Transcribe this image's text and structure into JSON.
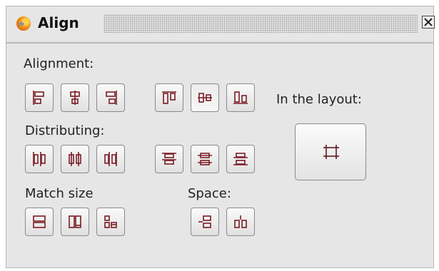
{
  "window": {
    "title": "Align"
  },
  "labels": {
    "alignment": "Alignment:",
    "in_the_layout": "In the layout:",
    "distributing": "Distributing:",
    "match_size": "Match size",
    "space": "Space:"
  },
  "icons": {
    "app": "gimp-wilber-icon",
    "close": "close-icon",
    "align_left": "align-left-icon",
    "align_center_horizontal": "align-center-horizontal-icon",
    "align_right": "align-right-icon",
    "align_top": "align-top-icon",
    "align_center_vertical": "align-center-vertical-icon",
    "align_bottom": "align-bottom-icon",
    "distribute_left": "distribute-left-icon",
    "distribute_center_horizontal": "distribute-center-horizontal-icon",
    "distribute_right": "distribute-right-icon",
    "distribute_top": "distribute-top-icon",
    "distribute_center_vertical": "distribute-center-vertical-icon",
    "distribute_bottom": "distribute-bottom-icon",
    "match_width": "match-width-icon",
    "match_height": "match-height-icon",
    "match_both": "match-size-both-icon",
    "space_vertical": "space-vertical-icon",
    "space_horizontal": "space-horizontal-icon",
    "layout_toggle": "align-to-layout-icon"
  },
  "colors": {
    "icon_stroke": "#7a1c24",
    "panel_bg": "#e6e6e6",
    "border": "#8a8a8a"
  }
}
